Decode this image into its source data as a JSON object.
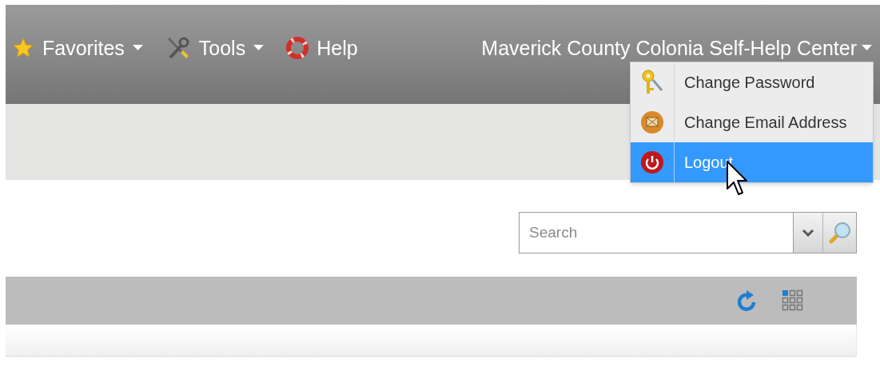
{
  "nav": {
    "items": [
      {
        "label": "Favorites",
        "has_menu": true
      },
      {
        "label": "Tools",
        "has_menu": true
      },
      {
        "label": "Help",
        "has_menu": false
      }
    ],
    "account": {
      "label": "Maverick County Colonia Self-Help Center",
      "has_menu": true,
      "expanded": true
    }
  },
  "account_menu": [
    {
      "label": "Change Password",
      "selected": false
    },
    {
      "label": "Change Email Address",
      "selected": false
    },
    {
      "label": "Logout",
      "selected": true
    }
  ],
  "search": {
    "placeholder": "Search"
  }
}
